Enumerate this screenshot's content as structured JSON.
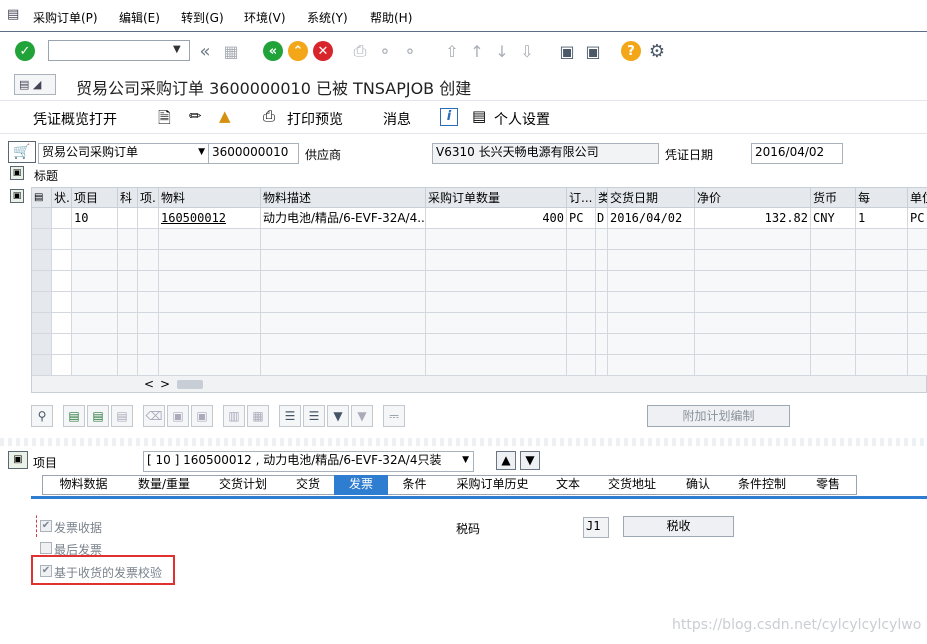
{
  "menu": {
    "items": [
      "采购订单(P)",
      "编辑(E)",
      "转到(G)",
      "环境(V)",
      "系统(Y)",
      "帮助(H)"
    ]
  },
  "toolbar": {
    "command_value": "",
    "icons": [
      "check-icon",
      "back-double-icon",
      "save-icon",
      "back-icon",
      "exit-icon",
      "cancel-icon",
      "print-icon",
      "find-icon",
      "find-next-icon",
      "first-page-icon",
      "prev-page-icon",
      "next-page-icon",
      "last-page-icon",
      "new-session-icon",
      "shortcut-icon",
      "help-icon",
      "settings-icon"
    ]
  },
  "title": {
    "text": "贸易公司采购订单 3600000010 已被 TNSAPJOB 创建"
  },
  "app_toolbar": {
    "doc_overview": "凭证概览打开",
    "print_preview": "打印预览",
    "messages": "消息",
    "personal_settings": "个人设置"
  },
  "header": {
    "doc_type": "贸易公司采购订单",
    "po_number": "3600000010",
    "vendor_label": "供应商",
    "vendor_value": "V6310 长兴天畅电源有限公司",
    "doc_date_label": "凭证日期",
    "doc_date_value": "2016/04/02",
    "section_header": "标题"
  },
  "grid": {
    "columns": [
      "",
      "状.",
      "项目",
      "科",
      "项.",
      "物料",
      "物料描述",
      "采购订单数量",
      "订...",
      "类",
      "交货日期",
      "净价",
      "货币",
      "每",
      "单位"
    ],
    "rows": [
      {
        "status": "",
        "item": "10",
        "acct": "",
        "cat": "",
        "material": "160500012",
        "description": "动力电池/精品/6-EVF-32A/4...",
        "qty": "400",
        "uom": "PC",
        "type": "D",
        "delivery_date": "2016/04/02",
        "net_price": "132.82",
        "currency": "CNY",
        "per": "1",
        "unit": "PC"
      }
    ],
    "nav": "< >",
    "additional_planning": "附加计划编制"
  },
  "item_detail": {
    "label": "项目",
    "selected": "[ 10 ] 160500012 , 动力电池/精品/6-EVF-32A/4只装",
    "tabs": [
      "物料数据",
      "数量/重量",
      "交货计划",
      "交货",
      "发票",
      "条件",
      "采购订单历史",
      "文本",
      "交货地址",
      "确认",
      "条件控制",
      "零售"
    ],
    "active_tab": "发票"
  },
  "invoice_tab": {
    "invoice_receipt_label": "发票收据",
    "invoice_receipt_checked": true,
    "final_invoice_label": "最后发票",
    "final_invoice_checked": false,
    "gr_based_iv_label": "基于收货的发票校验",
    "gr_based_iv_checked": true,
    "tax_code_label": "税码",
    "tax_code_value": "J1",
    "taxes_button": "税收"
  },
  "watermark": "https://blog.csdn.net/cylcylcylcylwo",
  "colors": {
    "accent": "#2e7dd1",
    "highlight_box": "#e03030",
    "check_green": "#22a33a",
    "cancel_red": "#d8242b",
    "exit_orange": "#f2a618"
  }
}
